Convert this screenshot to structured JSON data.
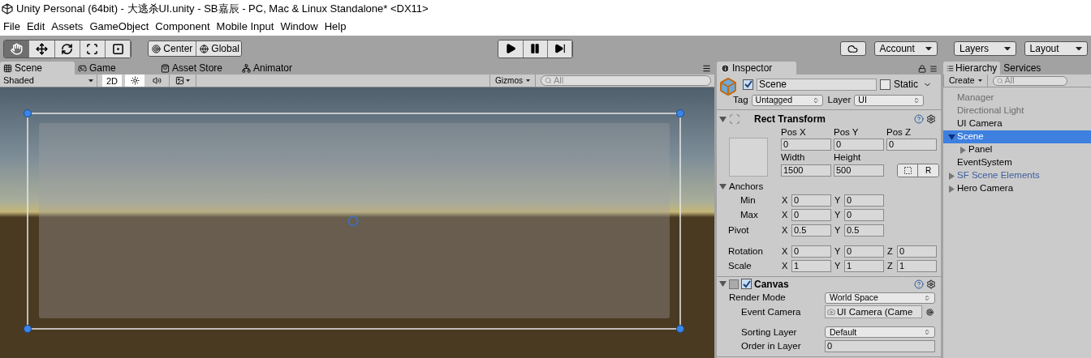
{
  "window": {
    "title": "Unity Personal (64bit) - 大逃杀UI.unity - SB嘉辰 - PC, Mac & Linux Standalone* <DX11>"
  },
  "menu": [
    "File",
    "Edit",
    "Assets",
    "GameObject",
    "Component",
    "Mobile Input",
    "Window",
    "Help"
  ],
  "toolbar": {
    "tools": [
      {
        "kind": "hand",
        "selected": true
      },
      {
        "kind": "move",
        "selected": false
      },
      {
        "kind": "rotate",
        "selected": false
      },
      {
        "kind": "scale",
        "selected": false
      },
      {
        "kind": "rect",
        "selected": false
      }
    ],
    "pivot": [
      {
        "kind": "pivot",
        "label": "Center"
      },
      {
        "kind": "globe",
        "label": "Global"
      }
    ],
    "play": [
      {
        "kind": "play",
        "selected": false
      },
      {
        "kind": "pause",
        "selected": false
      },
      {
        "kind": "step",
        "selected": false
      }
    ],
    "account": "Account",
    "layers": "Layers",
    "layout": "Layout"
  },
  "scene": {
    "tabs": [
      {
        "kind": "grid",
        "label": "Scene",
        "selected": true
      },
      {
        "kind": "game",
        "label": "Game",
        "selected": false
      },
      {
        "kind": "store",
        "label": "Asset Store",
        "selected": false
      },
      {
        "kind": "animator",
        "label": "Animator",
        "selected": false
      }
    ],
    "shading": "Shaded",
    "mode_2d": {
      "label": "2D",
      "on": true
    },
    "gizmos": "Gizmos",
    "search": {
      "placeholder": "All"
    }
  },
  "inspector": {
    "tab": "Inspector",
    "object": {
      "active": true,
      "name": "Scene",
      "static": {
        "label": "Static",
        "checked": false
      },
      "tag_label": "Tag",
      "tag": "Untagged",
      "layer_label": "Layer",
      "layer": "UI"
    },
    "rect_transform": {
      "title": "Rect Transform",
      "expanded": true,
      "top_labels": [
        "Pos X",
        "Pos Y",
        "Pos Z"
      ],
      "top_values": [
        "0",
        "0",
        "0"
      ],
      "size_labels": [
        "Width",
        "Height"
      ],
      "size_values": [
        "1500",
        "500"
      ],
      "raw_button": "R",
      "anchors": {
        "label": "Anchors",
        "expanded": true,
        "rows": [
          {
            "label": "Min",
            "axes": [
              {
                "axis": "X",
                "value": "0"
              },
              {
                "axis": "Y",
                "value": "0"
              }
            ]
          },
          {
            "label": "Max",
            "axes": [
              {
                "axis": "X",
                "value": "0"
              },
              {
                "axis": "Y",
                "value": "0"
              }
            ]
          }
        ]
      },
      "rows": [
        {
          "label": "Pivot",
          "axes": [
            {
              "axis": "X",
              "value": "0.5"
            },
            {
              "axis": "Y",
              "value": "0.5"
            }
          ]
        },
        {
          "label": "Rotation",
          "axes": [
            {
              "axis": "X",
              "value": "0"
            },
            {
              "axis": "Y",
              "value": "0"
            },
            {
              "axis": "Z",
              "value": "0"
            }
          ]
        },
        {
          "label": "Scale",
          "axes": [
            {
              "axis": "X",
              "value": "1"
            },
            {
              "axis": "Y",
              "value": "1"
            },
            {
              "axis": "Z",
              "value": "1"
            }
          ]
        }
      ]
    },
    "canvas": {
      "title": "Canvas",
      "expanded": true,
      "enabled": true,
      "fields": [
        {
          "kind": "dropdown",
          "label": "Render Mode",
          "value": "World Space",
          "indent": false
        },
        {
          "kind": "object",
          "label": "Event Camera",
          "value": "UI Camera (Came",
          "indent": true
        },
        {
          "kind": "dropdown",
          "label": "Sorting Layer",
          "value": "Default",
          "indent": true
        },
        {
          "kind": "text",
          "label": "Order in Layer",
          "value": "0",
          "indent": true
        }
      ]
    }
  },
  "hierarchy": {
    "tabs": [
      {
        "label": "Hierarchy",
        "selected": true
      },
      {
        "label": "Services",
        "selected": false
      }
    ],
    "create": "Create",
    "search": {
      "placeholder": "All"
    },
    "items": [
      {
        "label": "Manager",
        "active": false,
        "prefab": false,
        "selected": false
      },
      {
        "label": "Directional Light",
        "active": false,
        "prefab": false,
        "selected": false
      },
      {
        "label": "UI Camera",
        "active": true,
        "prefab": false,
        "selected": false
      },
      {
        "label": "Scene",
        "active": true,
        "prefab": false,
        "selected": true,
        "expanded": true,
        "children": [
          {
            "label": "Panel",
            "active": true,
            "prefab": false,
            "selected": false,
            "expanded": false
          }
        ]
      },
      {
        "label": "EventSystem",
        "active": true,
        "prefab": false,
        "selected": false
      },
      {
        "label": "SF Scene Elements",
        "active": true,
        "prefab": true,
        "selected": false,
        "expanded": false
      },
      {
        "label": "Hero Camera",
        "active": true,
        "prefab": false,
        "selected": false,
        "expanded": false
      }
    ]
  }
}
